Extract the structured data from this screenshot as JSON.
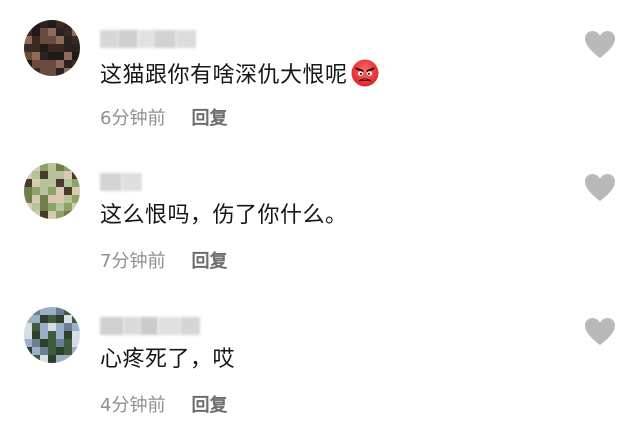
{
  "comments": [
    {
      "avatar": {
        "name": "avatar-blurred",
        "palette": [
          "#3b2a24",
          "#6a4b3e",
          "#1f1a18",
          "#8c6b58",
          "#2a2220"
        ]
      },
      "username_blocks": [
        "#d7d7d7",
        "#cfcfcf",
        "#e1e1e1",
        "#d2d2d2",
        "#dcdcdc"
      ],
      "content": "这猫跟你有啥深仇大恨呢",
      "emoji": "angry-face-icon",
      "time": "6分钟前",
      "reply_label": "回复",
      "like_icon": "heart-icon"
    },
    {
      "avatar": {
        "name": "avatar-blurred",
        "palette": [
          "#8ba366",
          "#b7c39a",
          "#4a3a2c",
          "#d9c9b0",
          "#6e7f4a"
        ]
      },
      "username_blocks": [
        "#d4d4d4",
        "#dedede"
      ],
      "content": "这么恨吗，伤了你什么。",
      "emoji": "",
      "time": "7分钟前",
      "reply_label": "回复",
      "like_icon": "heart-icon"
    },
    {
      "avatar": {
        "name": "avatar-blurred",
        "palette": [
          "#3f5d3a",
          "#9bb0c8",
          "#d7dde6",
          "#6b7f93",
          "#2e3f2b"
        ]
      },
      "username_blocks": [
        "#d0d0d0",
        "#dadada",
        "#cbcbcb",
        "#e0e0e0",
        "#d5d5d5"
      ],
      "content": "心疼死了，哎",
      "emoji": "",
      "time": "4分钟前",
      "reply_label": "回复",
      "like_icon": "heart-icon"
    }
  ],
  "colors": {
    "text": "#161616",
    "meta": "#8f8f8f",
    "reply": "#6e6e6e",
    "heart": "#b9b9b9"
  }
}
